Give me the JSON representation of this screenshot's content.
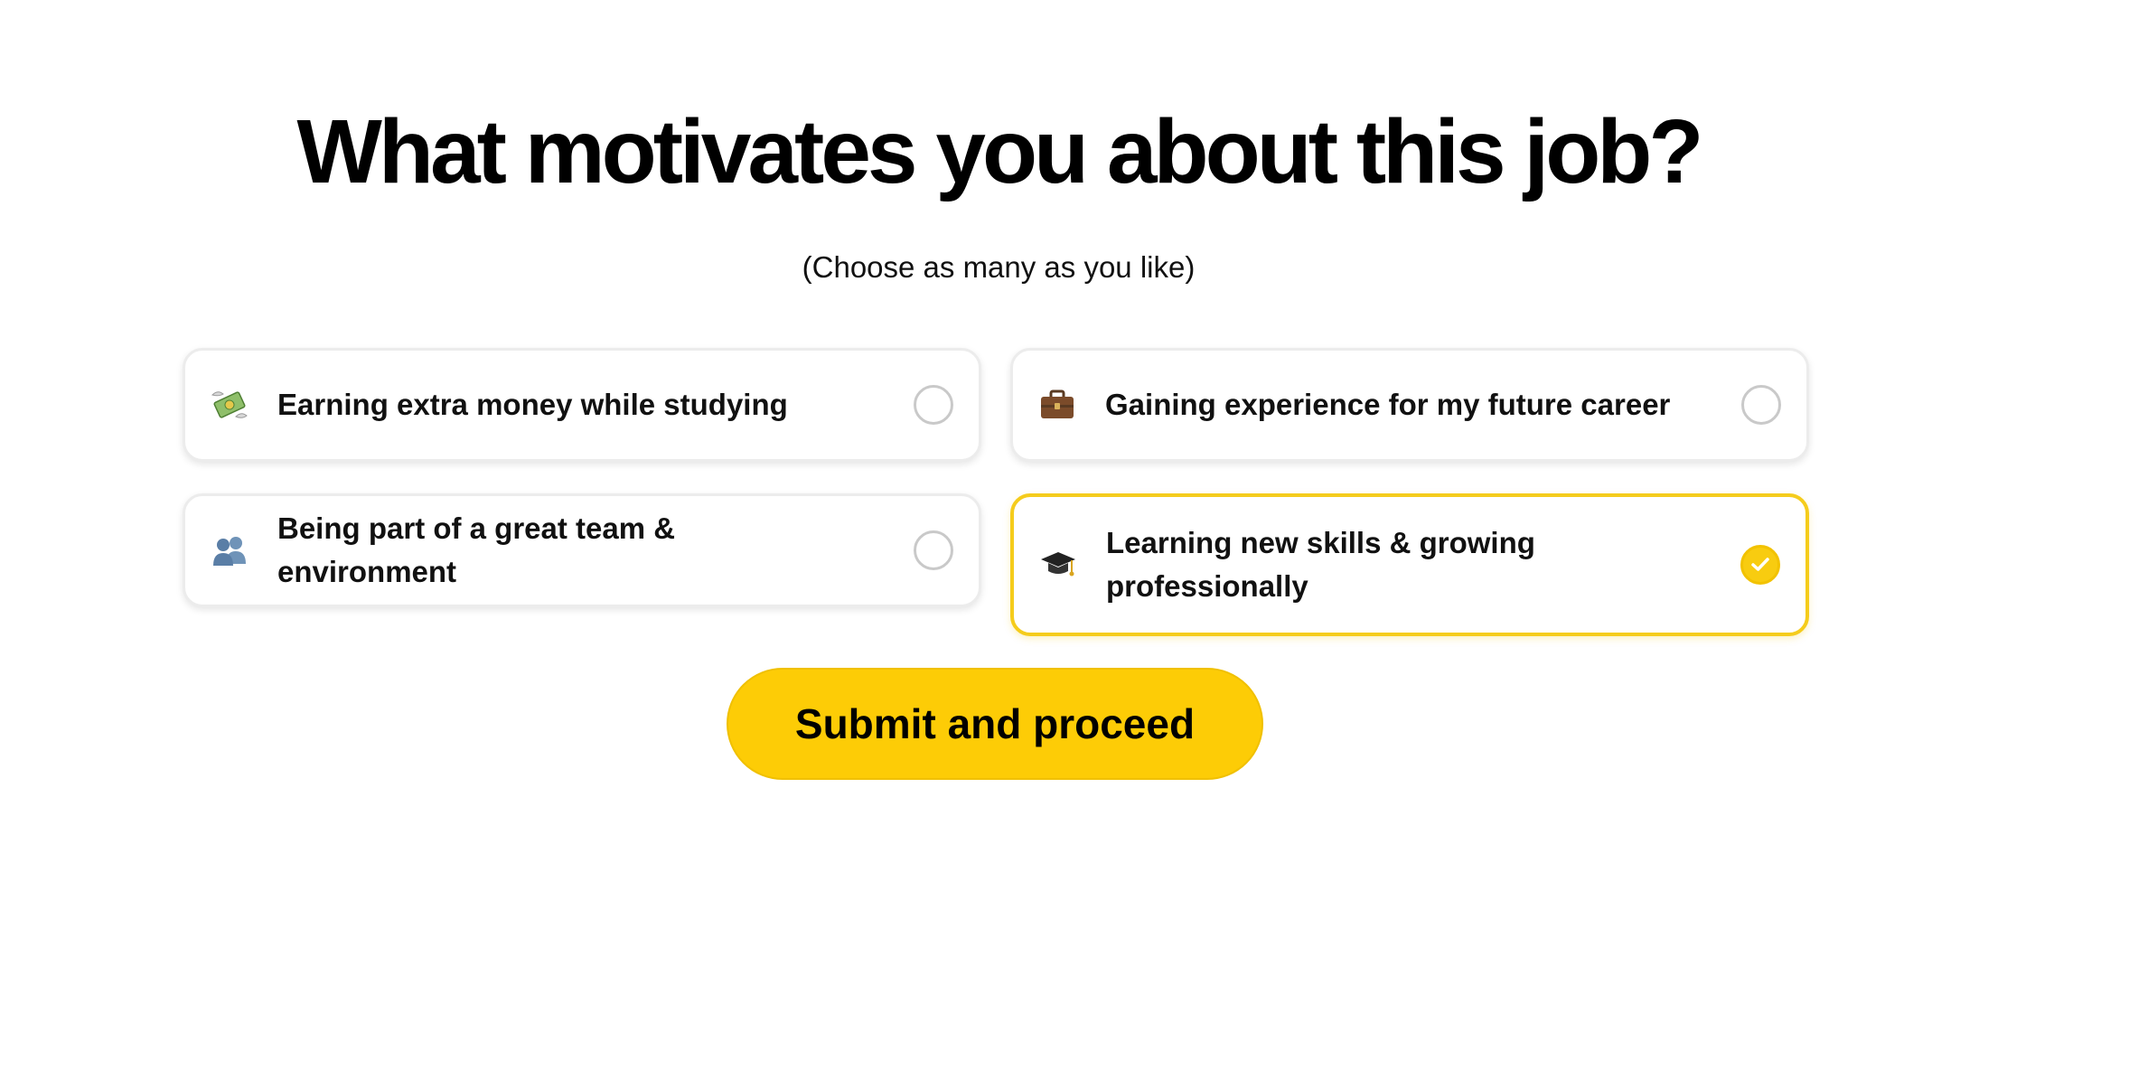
{
  "header": {
    "title": "What motivates you about this job?",
    "subtitle": "(Choose as many as you like)"
  },
  "options": [
    {
      "label": "Earning extra money while studying",
      "icon": "money-with-wings-icon",
      "selected": false
    },
    {
      "label": "Gaining experience for my future career",
      "icon": "briefcase-icon",
      "selected": false
    },
    {
      "label": "Being part of a great team & environment",
      "icon": "two-people-icon",
      "selected": false
    },
    {
      "label": "Learning new skills & growing professionally",
      "icon": "graduation-cap-icon",
      "selected": true
    }
  ],
  "submit": {
    "label": "Submit and proceed"
  },
  "colors": {
    "accent": "#fdcc06",
    "selected_border": "#f5cc1c",
    "unselected_radio": "#c9c9c9"
  }
}
